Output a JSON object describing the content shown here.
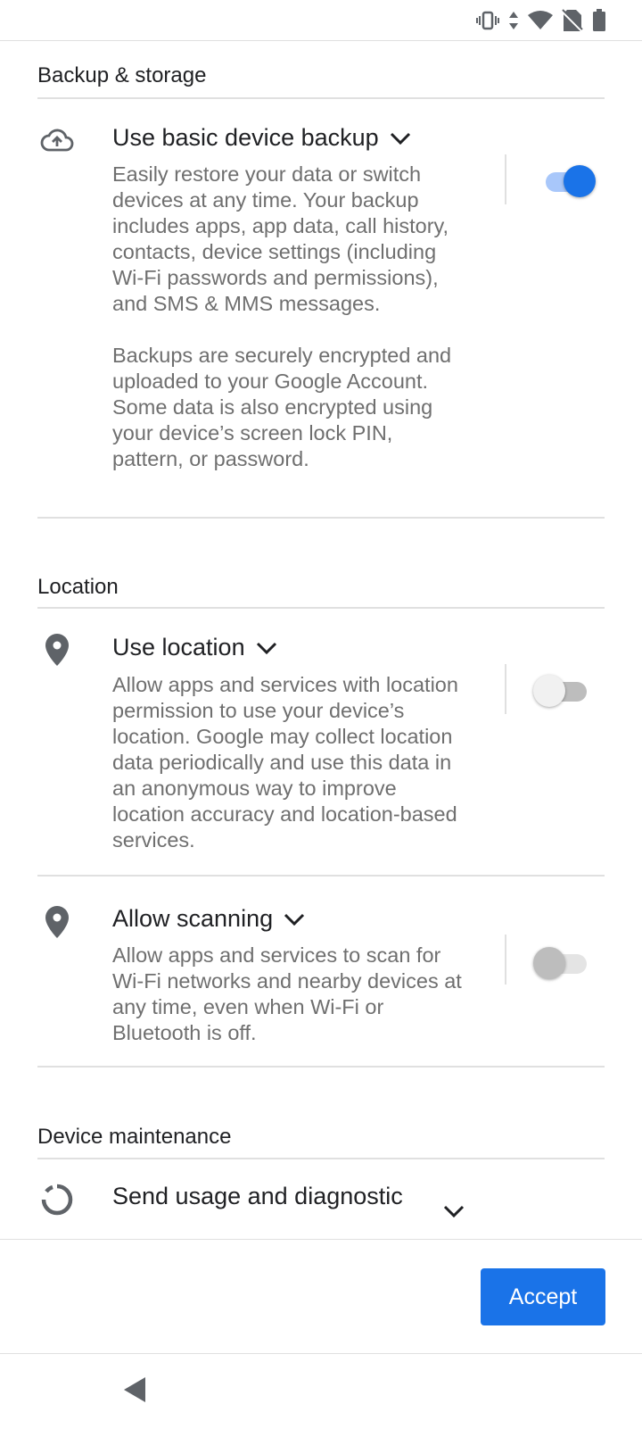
{
  "status_bar": {
    "icons": [
      "vibrate-icon",
      "data-arrows-icon",
      "wifi-icon",
      "no-sim-icon",
      "battery-icon"
    ]
  },
  "sections": {
    "backup": {
      "title": "Backup & storage"
    },
    "location": {
      "title": "Location"
    },
    "maintenance": {
      "title": "Device maintenance"
    }
  },
  "items": {
    "backup": {
      "icon": "cloud-upload-icon",
      "title": "Use basic device backup",
      "description": "Easily restore your data or switch devices at any time. Your backup includes apps, app data, call history, contacts, device settings (including Wi-Fi passwords and permissions), and SMS & MMS messages.\n\nBackups are securely encrypted and uploaded to your Google Account. Some data is also encrypted using your device’s screen lock PIN, pattern, or password.",
      "enabled": true
    },
    "use_location": {
      "icon": "location-pin-icon",
      "title": "Use location",
      "description": "Allow apps and services with location permission to use your device’s location. Google may collect location data periodically and use this data in an anonymous way to improve location accuracy and location-based services.",
      "enabled": false
    },
    "scanning": {
      "icon": "location-pin-icon",
      "title": "Allow scanning",
      "description": "Allow apps and services to scan for Wi-Fi networks and nearby devices at any time, even when Wi-Fi or Bluetooth is off.",
      "enabled": false
    },
    "diagnostics": {
      "icon": "diagnostics-ring-icon",
      "title": "Send usage and diagnostic"
    }
  },
  "footer": {
    "accept_label": "Accept"
  },
  "colors": {
    "accent": "#1a73e8",
    "text_primary": "#202124",
    "text_secondary": "#6f6f6f",
    "divider": "#e0e0e0"
  }
}
